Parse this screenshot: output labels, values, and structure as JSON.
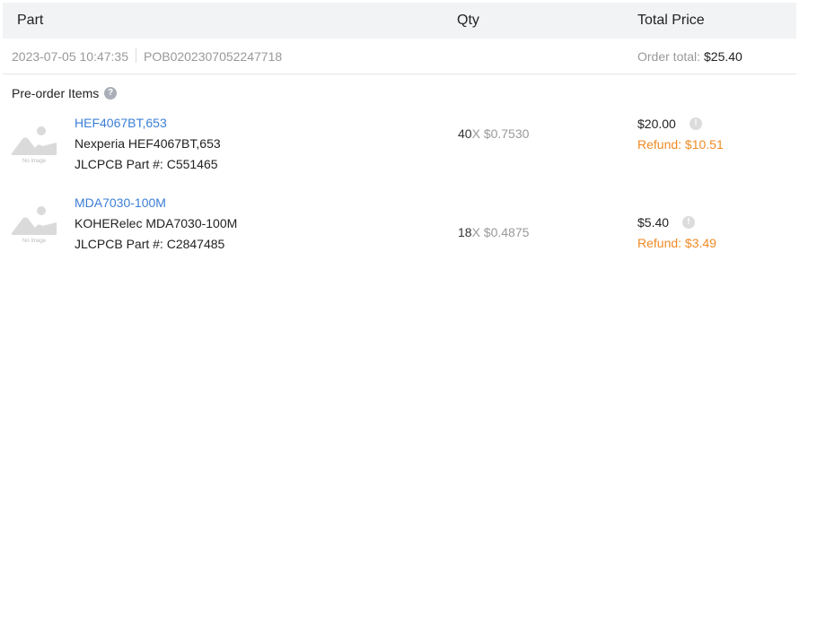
{
  "header": {
    "part": "Part",
    "qty": "Qty",
    "total_price": "Total Price"
  },
  "order": {
    "datetime": "2023-07-05 10:47:35",
    "number": "POB0202307052247718",
    "total_label": "Order total:",
    "total_value": "$25.40"
  },
  "section": {
    "title": "Pre-order Items"
  },
  "no_image_text": "No Image",
  "items": [
    {
      "name": "HEF4067BT,653",
      "description": "Nexperia HEF4067BT,653",
      "part_code": "JLCPCB Part #: C551465",
      "qty": "40",
      "unit_price": "X $0.7530",
      "price": "$20.00",
      "refund": "Refund: $10.51"
    },
    {
      "name": "MDA7030-100M",
      "description": "KOHERelec MDA7030-100M",
      "part_code": "JLCPCB Part #: C2847485",
      "qty": "18",
      "unit_price": "X $0.4875",
      "price": "$5.40",
      "refund": "Refund: $3.49"
    }
  ],
  "colors": {
    "link": "#3b7ed6",
    "refund": "#f08a24",
    "header_bg": "#f2f3f5"
  }
}
